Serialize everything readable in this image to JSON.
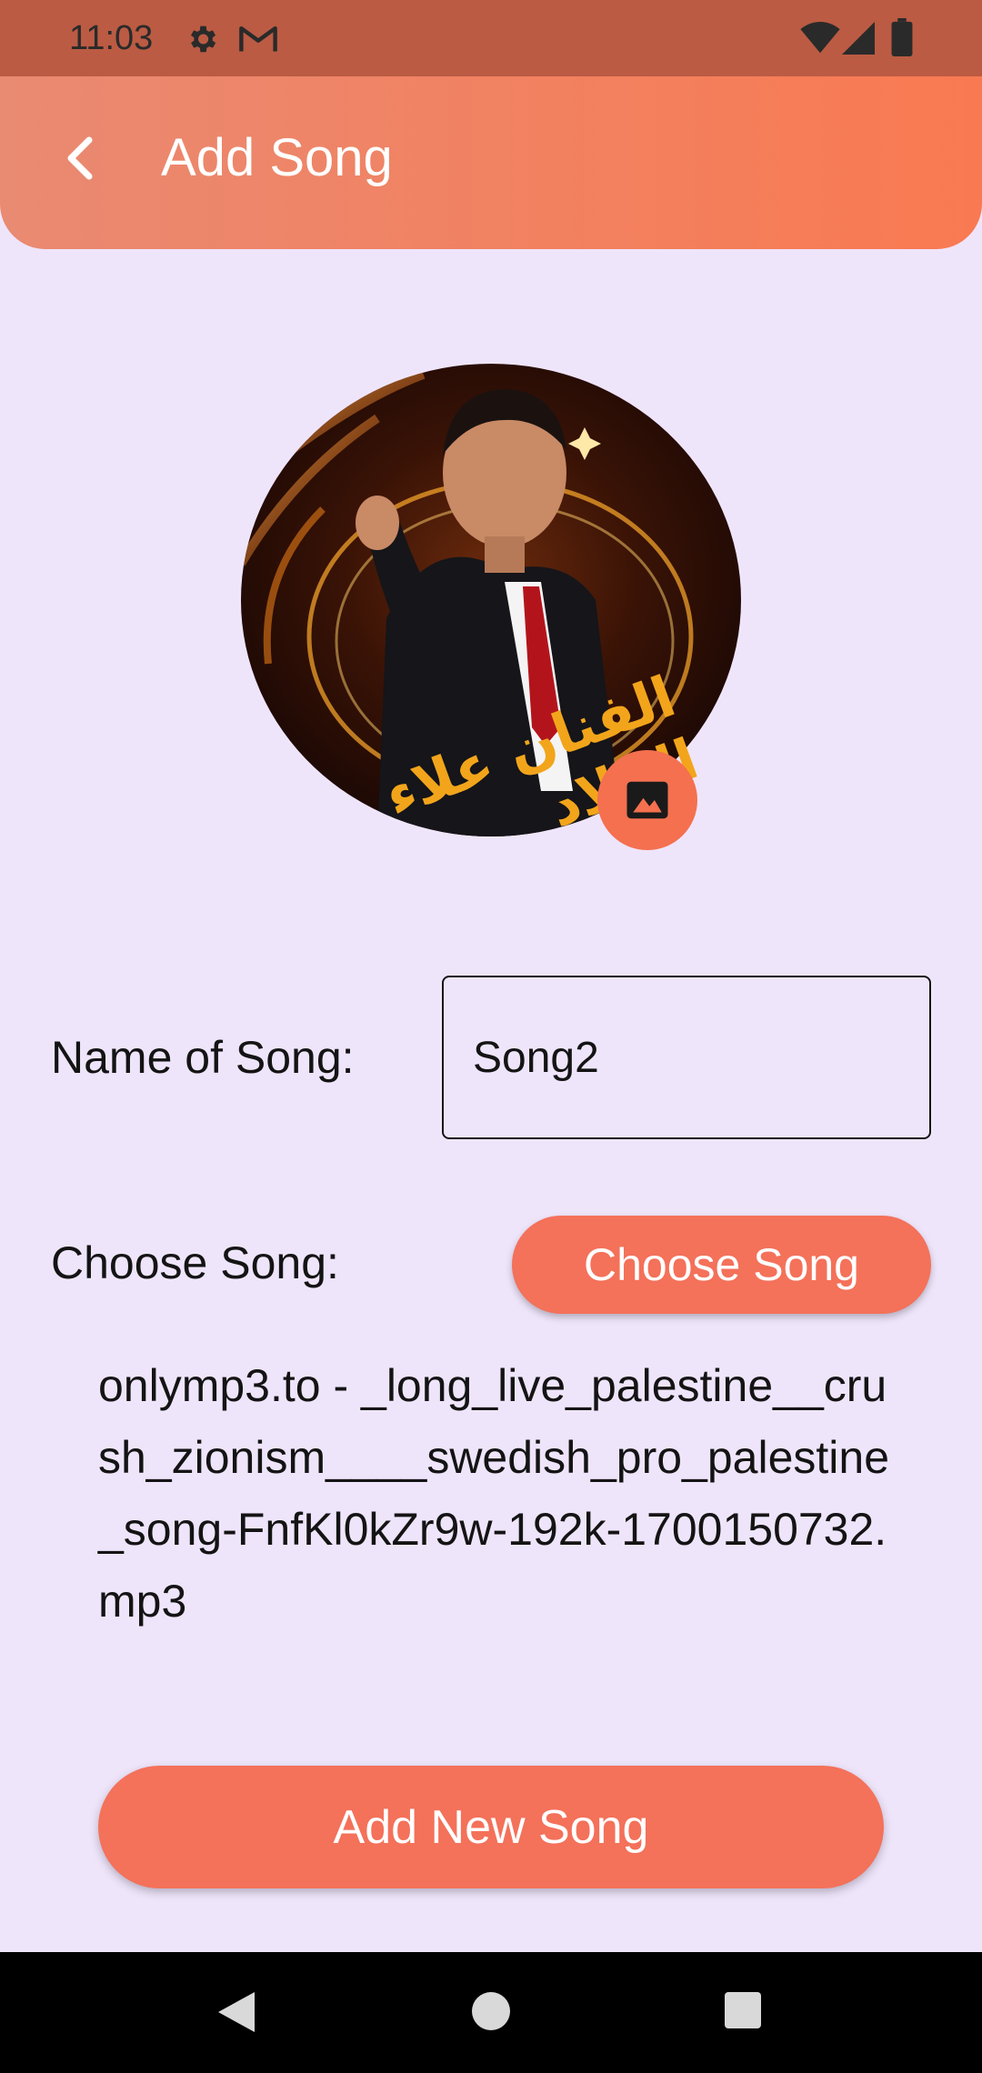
{
  "status_bar": {
    "time": "11:03",
    "icons": [
      "gear-icon",
      "gmail-icon",
      "wifi-icon",
      "signal-icon",
      "battery-icon"
    ]
  },
  "app_bar": {
    "title": "Add Song",
    "back_icon": "chevron-left-icon",
    "gradient": [
      "#e98a72",
      "#f97a52"
    ]
  },
  "avatar": {
    "caption": "الفنان علاء الجلاد",
    "pick_image_icon": "image-icon"
  },
  "form": {
    "name_label": "Name of Song:",
    "name_value": "Song2",
    "choose_label": "Choose Song:",
    "choose_button": "Choose Song",
    "file_name": "onlymp3.to - _long_live_palestine__crush_zionism____swedish_pro_palestine_song-FnfKl0kZr9w-192k-1700150732.mp3",
    "submit_button": "Add New Song"
  },
  "colors": {
    "background": "#efe5fb",
    "accent": "#f4715a",
    "status_bar": "#bb5b43"
  },
  "nav_bar": {
    "icons": [
      "back-triangle-icon",
      "home-circle-icon",
      "recents-square-icon"
    ]
  }
}
